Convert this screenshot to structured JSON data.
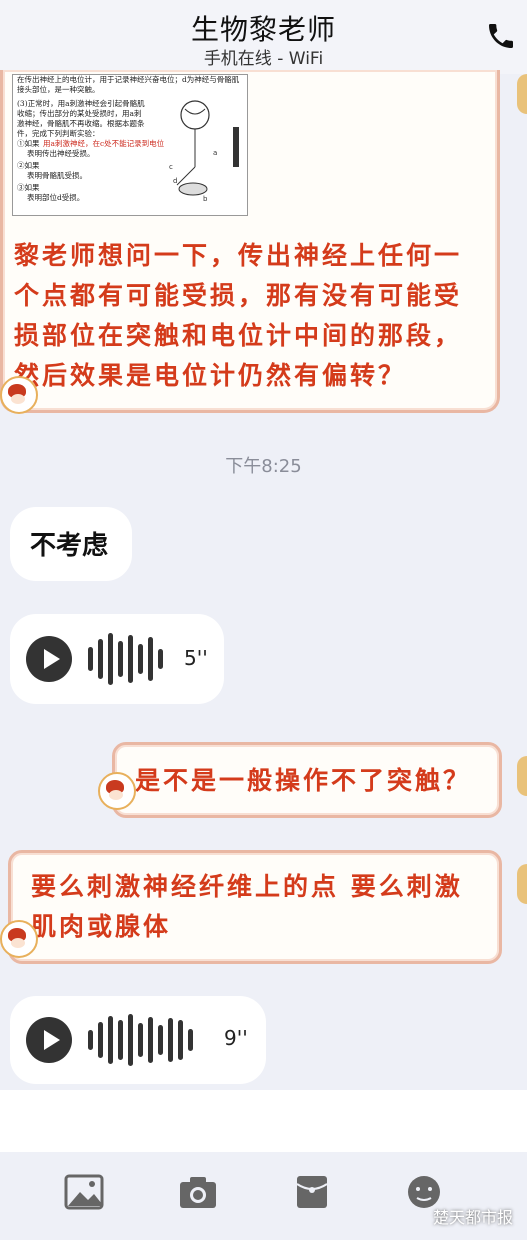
{
  "header": {
    "title": "生物黎老师",
    "status": "手机在线 - WiFi"
  },
  "messages": {
    "image_card": {
      "lines": [
        "在传出神经上的电位计，用于记录神经兴奋电位；d为神经与骨骼肌",
        "接头部位，是一种突触。",
        "(3)正常时，用a刺激神经会引起骨骼肌",
        "收缩；传出部分的某处受损时，用a刺",
        "激神经，骨骼肌不再收缩。根据本题条",
        "件，完成下列判断实验：",
        "①如果",
        "表明传出神经受损。",
        "②如果",
        "表明骨骼肌受损。",
        "③如果",
        "表明部位d受损。"
      ],
      "red_line": "用a刺激神经，在c处不能记录到电位"
    },
    "question": "黎老师想问一下，传出神经上任何一个点都有可能受损，那有没有可能受损部位在突触和电位计中间的那段，然后效果是电位计仍然有偏转？",
    "timestamp": "下午8:25",
    "reply_text": "不考虑",
    "voice_1_duration": "5''",
    "my_question": "是不是一般操作不了突触？",
    "my_answer": "要么刺激神经纤维上的点 要么刺激肌肉或腺体",
    "voice_2_duration": "9''"
  },
  "toolbar": {
    "icons": [
      "image-icon",
      "camera-icon",
      "red-packet-icon",
      "emoji-icon"
    ]
  },
  "watermark": "楚天都市报",
  "colors": {
    "handwriting": "#d43b1b",
    "bubble_border": "#e9b7a3",
    "background": "#eef0f7"
  }
}
